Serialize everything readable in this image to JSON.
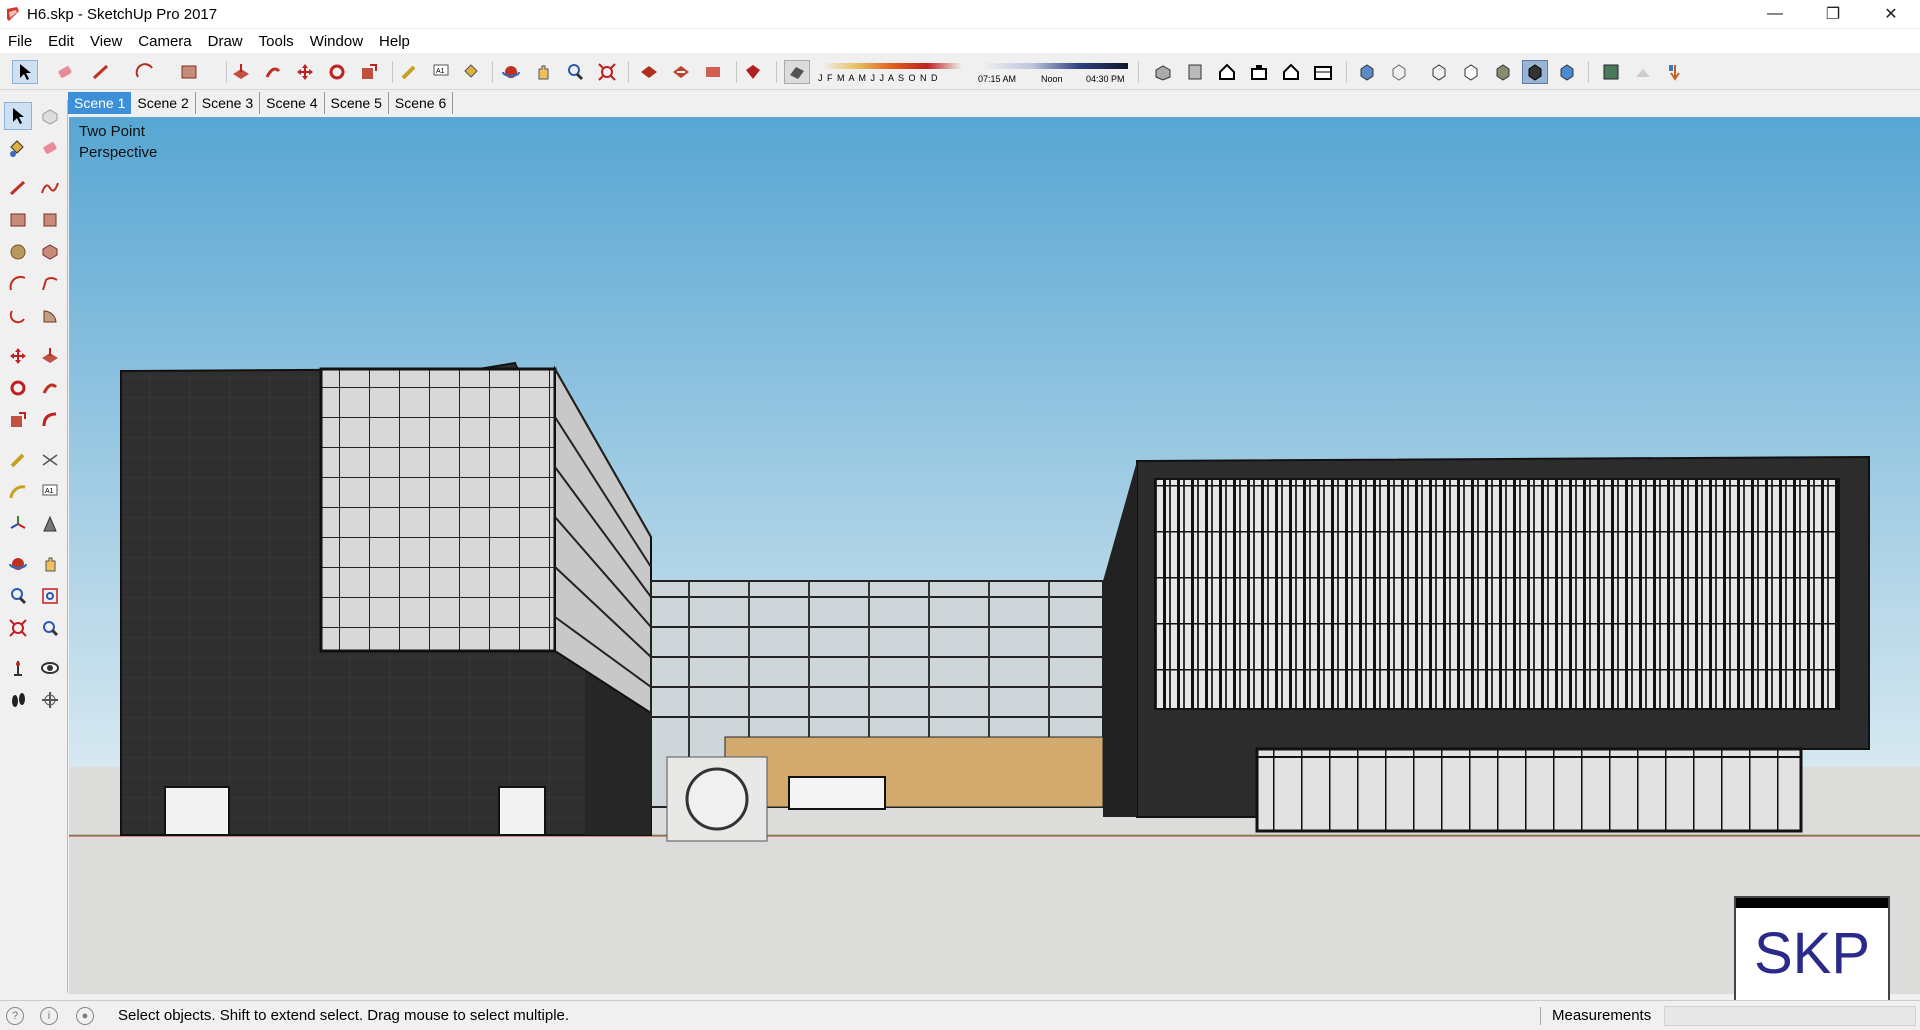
{
  "window": {
    "title": "H6.skp - SketchUp Pro 2017",
    "minimize_glyph": "—",
    "restore_glyph": "❐",
    "close_glyph": "✕"
  },
  "menu": [
    "File",
    "Edit",
    "View",
    "Camera",
    "Draw",
    "Tools",
    "Window",
    "Help"
  ],
  "toolbar": {
    "months": "J F M A M J J A S O N D",
    "time_start": "07:15 AM",
    "time_mid": "Noon",
    "time_end": "04:30 PM"
  },
  "scenes": {
    "tabs": [
      "Scene 1",
      "Scene 2",
      "Scene 3",
      "Scene 4",
      "Scene 5",
      "Scene 6"
    ],
    "active_index": 0
  },
  "viewport": {
    "camera_label": "Two Point\nPerspective"
  },
  "status": {
    "message": "Select objects. Shift to extend select. Drag mouse to select multiple.",
    "measurements_label": "Measurements",
    "measurements_value": ""
  },
  "badge": {
    "text": "SKP"
  },
  "colors": {
    "sky_top": "#57a6d3",
    "sky_bottom": "#cfe4ef",
    "ground": "#dcdcda",
    "building_dark": "#2e2e2e",
    "active_tab": "#3d8fd8"
  }
}
